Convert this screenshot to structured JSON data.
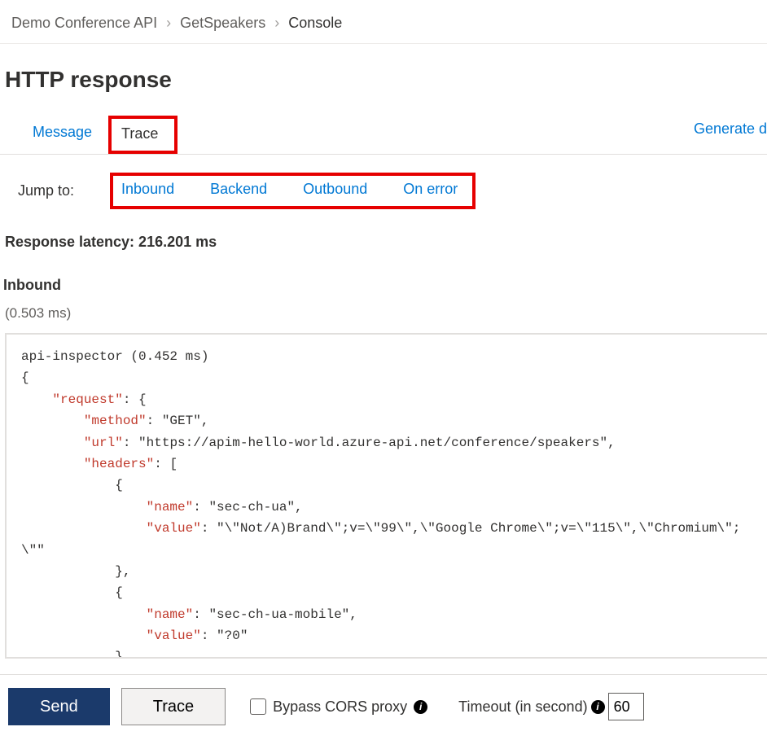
{
  "breadcrumb": {
    "items": [
      "Demo Conference API",
      "GetSpeakers",
      "Console"
    ]
  },
  "page_title": "HTTP response",
  "tabs": {
    "message": "Message",
    "trace": "Trace",
    "generate": "Generate d"
  },
  "jumpto": {
    "label": "Jump to:",
    "links": [
      "Inbound",
      "Backend",
      "Outbound",
      "On error"
    ]
  },
  "latency_label": "Response latency: 216.201 ms",
  "section": {
    "title": "Inbound",
    "time": "(0.503 ms)"
  },
  "code": {
    "header": "api-inspector (0.452 ms)",
    "brace_open": "{",
    "request_key": "\"request\"",
    "colon_brace": ": {",
    "method_key": "\"method\"",
    "method_val": ": \"GET\",",
    "url_key": "\"url\"",
    "url_val": ": \"https://apim-hello-world.azure-api.net/conference/speakers\",",
    "headers_key": "\"headers\"",
    "headers_open": ": [",
    "obj_open": "            {",
    "name_key": "\"name\"",
    "name1_val": ": \"sec-ch-ua\",",
    "value_key": "\"value\"",
    "value1_val": ": \"\\\"Not/A)Brand\\\";v=\\\"99\\\",\\\"Google Chrome\\\";v=\\\"115\\\",\\\"Chromium\\\";",
    "wrap_line": "\\\"\"",
    "obj_close": "            },",
    "obj_open2": "            {",
    "name2_val": ": \"sec-ch-ua-mobile\",",
    "value2_val": ": \"?0\"",
    "obj_close2": "            },"
  },
  "footer": {
    "send": "Send",
    "trace": "Trace",
    "bypass": "Bypass CORS proxy",
    "timeout_label": "Timeout (in second)",
    "timeout_value": "60"
  }
}
